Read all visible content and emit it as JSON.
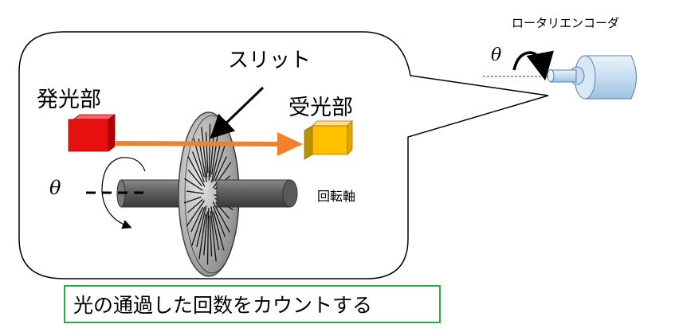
{
  "labels": {
    "encoder": "ロータリエンコーダ",
    "slit": "スリット",
    "emitter": "発光部",
    "receiver": "受光部",
    "shaft": "回転軸",
    "theta_encoder": "θ",
    "theta_shaft": "θ"
  },
  "caption": "光の通過した回数をカウントする",
  "colors": {
    "emitter": "#e81010",
    "receiver": "#ffc000",
    "beam": "#f0822e",
    "shaft": "#666666",
    "disk": "#b8b8b8",
    "encoder_body": "#c5ddf0",
    "caption_border": "#2aa84a"
  }
}
